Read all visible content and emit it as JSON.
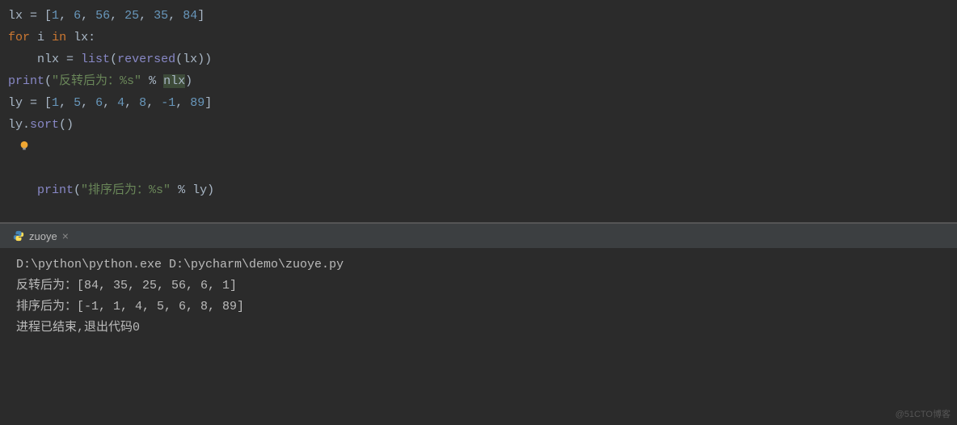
{
  "editor": {
    "line1": {
      "var": "lx",
      "eq": " = ",
      "bracket_open": "[",
      "n1": "1",
      "c1": ", ",
      "n2": "6",
      "c2": ", ",
      "n3": "56",
      "c3": ", ",
      "n4": "25",
      "c4": ", ",
      "n5": "35",
      "c5": ", ",
      "n6": "84",
      "bracket_close": "]"
    },
    "line2": {
      "for": "for",
      "sp1": " ",
      "i": "i",
      "sp2": " ",
      "in": "in",
      "sp3": " ",
      "lx": "lx",
      "colon": ":"
    },
    "line3": {
      "indent": "    ",
      "nlx": "nlx",
      "eq": " = ",
      "list": "list",
      "paren_open": "(",
      "reversed": "reversed",
      "paren_open2": "(",
      "lx": "lx",
      "paren_close": "))"
    },
    "line4": {
      "print": "print",
      "paren_open": "(",
      "str": "\"反转后为：%s\"",
      "sp": " ",
      "pct": "%",
      "sp2": " ",
      "nlx": "nlx",
      "paren_close": ")"
    },
    "line5": "",
    "line6": {
      "var": "ly",
      "eq": " = ",
      "bracket_open": "[",
      "n1": "1",
      "c1": ", ",
      "n2": "5",
      "c2": ", ",
      "n3": "6",
      "c3": ", ",
      "n4": "4",
      "c4": ", ",
      "n5": "8",
      "c5": ", ",
      "n6": "-1",
      "c6": ", ",
      "n7": "89",
      "bracket_close": "]"
    },
    "line7": {
      "ly": "ly",
      "dot": ".",
      "sort": "sort",
      "parens": "()"
    },
    "line8": {
      "print": "print",
      "paren_open": "(",
      "str": "\"排序后为：%s\"",
      "sp": " ",
      "pct": "%",
      "sp2": " ",
      "ly": "ly",
      "paren_close": ")"
    }
  },
  "tab": {
    "name": "zuoye",
    "close": "×"
  },
  "console": {
    "line1": "D:\\python\\python.exe D:\\pycharm\\demo\\zuoye.py",
    "line2": "反转后为：[84, 35, 25, 56, 6, 1]",
    "line3": "排序后为：[-1, 1, 4, 5, 6, 8, 89]",
    "line4": "",
    "line5": "进程已结束,退出代码0"
  },
  "watermark": "@51CTO博客"
}
